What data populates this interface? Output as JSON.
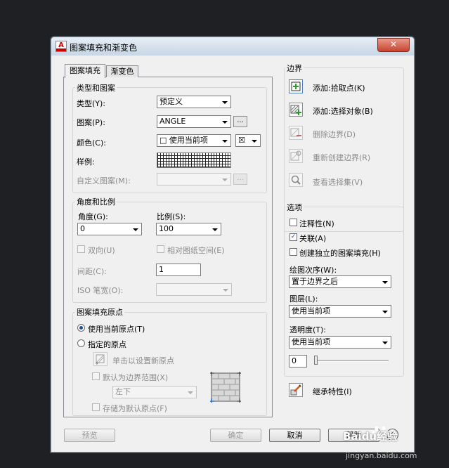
{
  "window": {
    "title": "图案填充和渐变色",
    "close": "✕"
  },
  "tabs": [
    "图案填充",
    "渐变色"
  ],
  "type_group": {
    "title": "类型和图案",
    "type_label": "类型(Y):",
    "type_value": "预定义",
    "pattern_label": "图案(P):",
    "pattern_value": "ANGLE",
    "color_label": "颜色(C):",
    "color_value": "□ 使用当前项",
    "bgcolor_value": "☒",
    "swatch_label": "样例:",
    "custom_label": "自定义图案(M):",
    "ellipsis": "..."
  },
  "angle_group": {
    "title": "角度和比例",
    "angle_label": "角度(G):",
    "angle_value": "0",
    "scale_label": "比例(S):",
    "scale_value": "100",
    "double_label": "双向(U)",
    "relative_label": "相对图纸空间(E)",
    "spacing_label": "间距(C):",
    "spacing_value": "1",
    "iso_label": "ISO 笔宽(O):"
  },
  "origin_group": {
    "title": "图案填充原点",
    "use_current": "使用当前原点(T)",
    "specified": "指定的原点",
    "click_set": "单击以设置新原点",
    "default_extent": "默认为边界范围(X)",
    "extent_value": "左下",
    "store_default": "存储为默认原点(F)"
  },
  "boundary": {
    "title": "边界",
    "add_pick": "添加:拾取点(K)",
    "add_select": "添加:选择对象(B)",
    "remove": "删除边界(D)",
    "recreate": "重新创建边界(R)",
    "view_sel": "查看选择集(V)"
  },
  "options": {
    "title": "选项",
    "annotative": "注释性(N)",
    "associative": "关联(A)",
    "separate": "创建独立的图案填充(H)",
    "draw_order_label": "绘图次序(W):",
    "draw_order_value": "置于边界之后",
    "layer_label": "图层(L):",
    "layer_value": "使用当前项",
    "transparency_label": "透明度(T):",
    "transparency_value": "使用当前项",
    "transparency_level": "0"
  },
  "inherit": "继承特性(I)",
  "footer": {
    "preview": "预览",
    "ok": "确定",
    "cancel": "取消",
    "help": "帮助"
  },
  "watermark": {
    "brand": "Baidu经验",
    "url": "jingyan.baidu.com"
  }
}
